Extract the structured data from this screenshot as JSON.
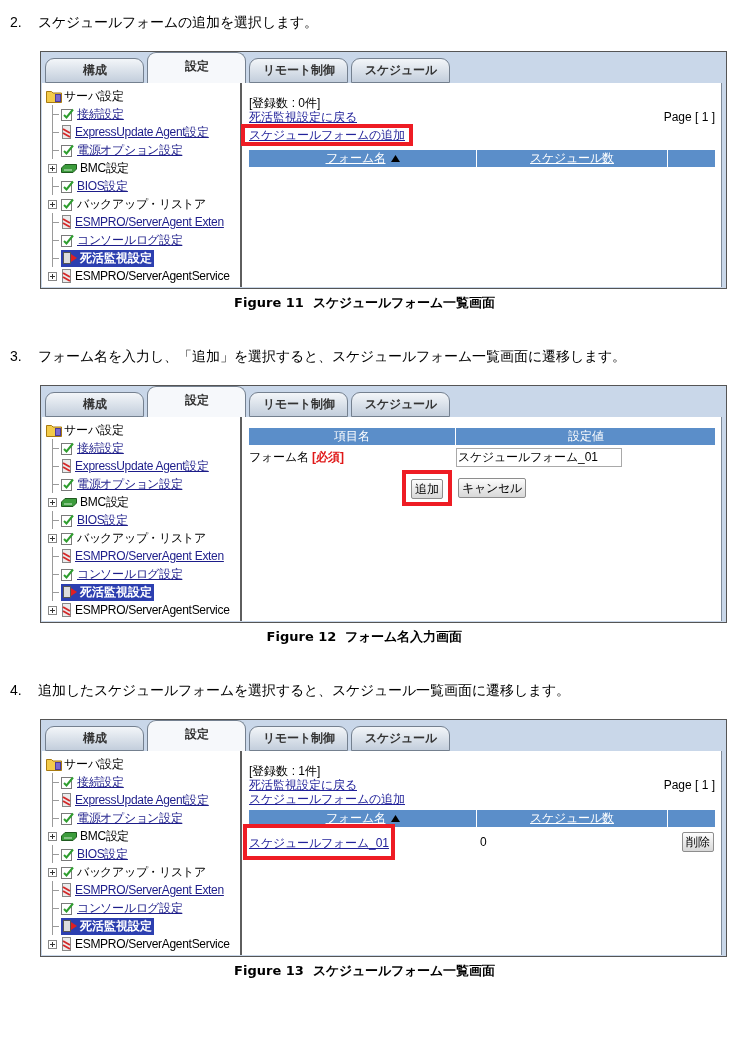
{
  "steps": [
    {
      "number": "2.",
      "text": "スケジュールフォームの追加を選択します。",
      "figure": {
        "tabs": [
          {
            "label": "構成",
            "selected": false
          },
          {
            "label": "設定",
            "selected": true
          },
          {
            "label": "リモート制御",
            "selected": false
          },
          {
            "label": "スケジュール",
            "selected": false
          }
        ],
        "sidebar": {
          "tree": [
            {
              "label": "サーバ設定",
              "kind": "folder",
              "selected": false,
              "children": [
                {
                  "label": "接続設定",
                  "kind": "page",
                  "expandable": false,
                  "selected": false
                },
                {
                  "label": "ExpressUpdate Agent設定",
                  "kind": "agent",
                  "expandable": false,
                  "selected": false
                },
                {
                  "label": "電源オプション設定",
                  "kind": "page",
                  "expandable": false,
                  "selected": false
                },
                {
                  "label": "BMC設定",
                  "kind": "board",
                  "expandable": true,
                  "selected": false
                },
                {
                  "label": "BIOS設定",
                  "kind": "page",
                  "expandable": false,
                  "selected": false
                },
                {
                  "label": "バックアップ・リストア",
                  "kind": "page",
                  "expandable": true,
                  "selected": false
                },
                {
                  "label": "ESMPRO/ServerAgent Exten",
                  "kind": "agent",
                  "expandable": false,
                  "selected": false
                },
                {
                  "label": "コンソールログ設定",
                  "kind": "page",
                  "expandable": false,
                  "selected": false
                },
                {
                  "label": "死活監視設定",
                  "kind": "monitor",
                  "expandable": false,
                  "selected": true
                },
                {
                  "label": "ESMPRO/ServerAgentService",
                  "kind": "agent",
                  "expandable": true,
                  "selected": false
                }
              ]
            }
          ]
        },
        "content": {
          "kind": "list",
          "count": "[登録数 : 0件]",
          "links": [
            {
              "label": "死活監視設定に戻る",
              "highlighted": false
            },
            {
              "label": "スケジュールフォームの追加",
              "highlighted": true
            }
          ],
          "page": "Page [ 1 ]",
          "columns": [
            {
              "label": "フォーム名",
              "sorted": true
            },
            {
              "label": "スケジュール数",
              "sorted": false
            },
            {
              "sorted": false
            }
          ]
        },
        "caption": "Figure 11  スケジュールフォーム一覧画面"
      }
    },
    {
      "number": "3.",
      "text": "フォーム名を入力し、「追加」を選択すると、スケジュールフォーム一覧画面に遷移します。",
      "figure": {
        "tabs": [
          {
            "label": "構成",
            "selected": false
          },
          {
            "label": "設定",
            "selected": true
          },
          {
            "label": "リモート制御",
            "selected": false
          },
          {
            "label": "スケジュール",
            "selected": false
          }
        ],
        "sidebar": {
          "tree": [
            {
              "label": "サーバ設定",
              "kind": "folder",
              "selected": false,
              "children": [
                {
                  "label": "接続設定",
                  "kind": "page",
                  "expandable": false,
                  "selected": false
                },
                {
                  "label": "ExpressUpdate Agent設定",
                  "kind": "agent",
                  "expandable": false,
                  "selected": false
                },
                {
                  "label": "電源オプション設定",
                  "kind": "page",
                  "expandable": false,
                  "selected": false
                },
                {
                  "label": "BMC設定",
                  "kind": "board",
                  "expandable": true,
                  "selected": false
                },
                {
                  "label": "BIOS設定",
                  "kind": "page",
                  "expandable": false,
                  "selected": false
                },
                {
                  "label": "バックアップ・リストア",
                  "kind": "page",
                  "expandable": true,
                  "selected": false
                },
                {
                  "label": "ESMPRO/ServerAgent Exten",
                  "kind": "agent",
                  "expandable": false,
                  "selected": false
                },
                {
                  "label": "コンソールログ設定",
                  "kind": "page",
                  "expandable": false,
                  "selected": false
                },
                {
                  "label": "死活監視設定",
                  "kind": "monitor",
                  "expandable": false,
                  "selected": true
                },
                {
                  "label": "ESMPRO/ServerAgentService",
                  "kind": "agent",
                  "expandable": true,
                  "selected": false
                }
              ]
            }
          ]
        },
        "content": {
          "kind": "form",
          "columns": [
            "項目名",
            "設定値"
          ],
          "fields": [
            {
              "label": "フォーム名",
              "required": "[必須]",
              "value": "スケジュールフォーム_01"
            }
          ],
          "buttons": [
            {
              "label": "追加",
              "highlighted": true
            },
            {
              "label": "キャンセル",
              "highlighted": false
            }
          ]
        },
        "caption": "Figure 12  フォーム名入力画面"
      }
    },
    {
      "number": "4.",
      "text": "追加したスケジュールフォームを選択すると、スケジュール一覧画面に遷移します。",
      "figure": {
        "tabs": [
          {
            "label": "構成",
            "selected": false
          },
          {
            "label": "設定",
            "selected": true
          },
          {
            "label": "リモート制御",
            "selected": false
          },
          {
            "label": "スケジュール",
            "selected": false
          }
        ],
        "sidebar": {
          "tree": [
            {
              "label": "サーバ設定",
              "kind": "folder",
              "selected": false,
              "children": [
                {
                  "label": "接続設定",
                  "kind": "page",
                  "expandable": false,
                  "selected": false
                },
                {
                  "label": "ExpressUpdate Agent設定",
                  "kind": "agent",
                  "expandable": false,
                  "selected": false
                },
                {
                  "label": "電源オプション設定",
                  "kind": "page",
                  "expandable": false,
                  "selected": false
                },
                {
                  "label": "BMC設定",
                  "kind": "board",
                  "expandable": true,
                  "selected": false
                },
                {
                  "label": "BIOS設定",
                  "kind": "page",
                  "expandable": false,
                  "selected": false
                },
                {
                  "label": "バックアップ・リストア",
                  "kind": "page",
                  "expandable": true,
                  "selected": false
                },
                {
                  "label": "ESMPRO/ServerAgent Exten",
                  "kind": "agent",
                  "expandable": false,
                  "selected": false
                },
                {
                  "label": "コンソールログ設定",
                  "kind": "page",
                  "expandable": false,
                  "selected": false
                },
                {
                  "label": "死活監視設定",
                  "kind": "monitor",
                  "expandable": false,
                  "selected": true
                },
                {
                  "label": "ESMPRO/ServerAgentService",
                  "kind": "agent",
                  "expandable": true,
                  "selected": false
                }
              ]
            }
          ]
        },
        "content": {
          "kind": "list",
          "count": "[登録数 : 1件]",
          "links": [
            {
              "label": "死活監視設定に戻る",
              "highlighted": false
            },
            {
              "label": "スケジュールフォームの追加",
              "highlighted": false
            }
          ],
          "page": "Page [ 1 ]",
          "columns": [
            {
              "label": "フォーム名",
              "sorted": true
            },
            {
              "label": "スケジュール数",
              "sorted": false
            },
            {
              "sorted": false
            }
          ],
          "rows": [
            {
              "name": "スケジュールフォーム_01",
              "schedules": "0",
              "button": "削除",
              "highlighted": true
            }
          ]
        },
        "caption": "Figure 13  スケジュールフォーム一覧画面"
      }
    }
  ]
}
